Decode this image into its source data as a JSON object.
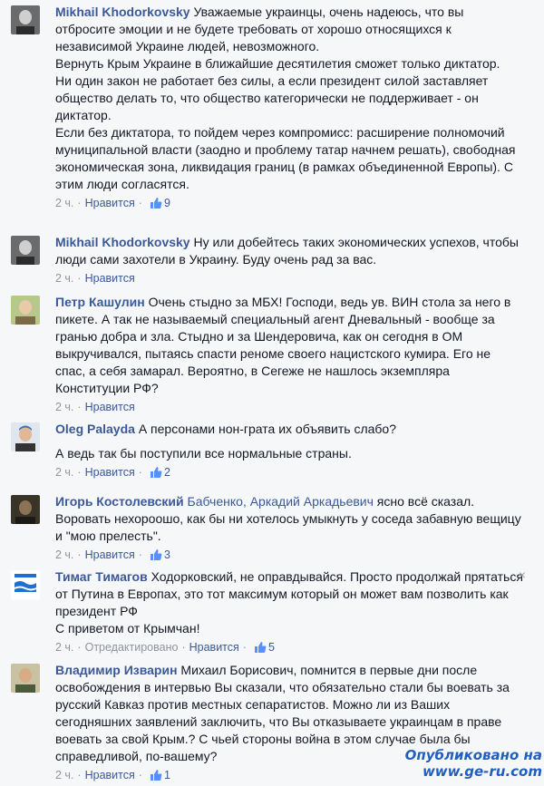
{
  "comments": [
    {
      "author": "Mikhail Khodorkovsky",
      "paragraphs": [
        "Уважаемые украинцы, очень надеюсь, что вы отбросите эмоции и не будете требовать от хорошо относящихся к независимой Украине людей, невозможного.",
        "Вернуть Крым Украине в ближайшие десятилетия сможет только диктатор.",
        "Ни один закон не работает без силы, а если президент силой заставляет общество делать то, что общество категорически не поддерживает - он диктатор.",
        "Если без диктатора, то пойдем через компромисс: расширение полномочий муниципальной власти (заодно и проблему татар начнем решать), свободная экономическая зона, ликвидация границ (в рамках объединенной Европы). С этим люди согласятся."
      ],
      "time": "2 ч.",
      "like_label": "Нравится",
      "likes": "9"
    },
    {
      "author": "Mikhail Khodorkovsky",
      "paragraphs": [
        "Ну или добейтесь таких экономических успехов, чтобы люди сами захотели в Украину. Буду очень рад за вас."
      ],
      "time": "2 ч.",
      "like_label": "Нравится",
      "likes": ""
    },
    {
      "author": "Петр Кашулин",
      "paragraphs": [
        "Очень стыдно за МБХ! Господи, ведь ув. ВИН стола за него в пикете. А так не называемый специальный агент Дневальный - вообще за гранью добра и зла. Стыдно и за Шендеровича, как он сегодня в ОМ выкручивался, пытаясь спасти реноме своего нацистского кумира. Его не спас, а себя замарал. Вероятно, в Сегеже не нашлось экземпляра Конституции РФ?"
      ],
      "time": "2 ч.",
      "like_label": "Нравится",
      "likes": ""
    },
    {
      "author": "Oleg Palayda",
      "paragraphs": [
        "А персонами нон-грата их объявить слабо?",
        "",
        "А ведь так бы поступили все нормальные страны."
      ],
      "time": "2 ч.",
      "like_label": "Нравится",
      "likes": "2"
    },
    {
      "author": "Игорь Костолевский",
      "mention": "Бабченко, Аркадий Аркадьевич",
      "paragraphs": [
        "ясно всё сказал. Воровать нехороошо, как бы ни хотелось умыкнуть у соседа забавную вещицу и \"мою прелесть\"."
      ],
      "time": "2 ч.",
      "like_label": "Нравится",
      "likes": "3"
    },
    {
      "author": "Тимаг Тимагов",
      "paragraphs": [
        "Ходорковский, не оправдывайся. Просто продолжай прятаться от Путина в Европах, это тот максимум который он может вам позволить как президент РФ",
        "С приветом от Крымчан!"
      ],
      "time": "2 ч.",
      "edited": "Отредактировано",
      "like_label": "Нравится",
      "likes": "5",
      "close": "×"
    },
    {
      "author": "Владимир Изварин",
      "paragraphs": [
        "Михаил Борисович, помнится в первые дни после освобождения в интервью Вы сказали, что обязательно стали бы воевать за русский Кавказ против местных сепаратистов. Можно ли из Ваших сегодняшних заявлений заключить, что Вы отказываете украинцам в праве воевать за свой Крым.? С чьей стороны война в этом случае была бы справедливой, по-вашему?"
      ],
      "time": "2 ч.",
      "like_label": "Нравится",
      "likes": "1"
    }
  ],
  "watermark": {
    "line1": "Опубликовано на",
    "line2": "www.ge-ru.com"
  },
  "colors": {
    "link": "#3b5998",
    "meta": "#90949c",
    "background": "#f6f7f9"
  }
}
